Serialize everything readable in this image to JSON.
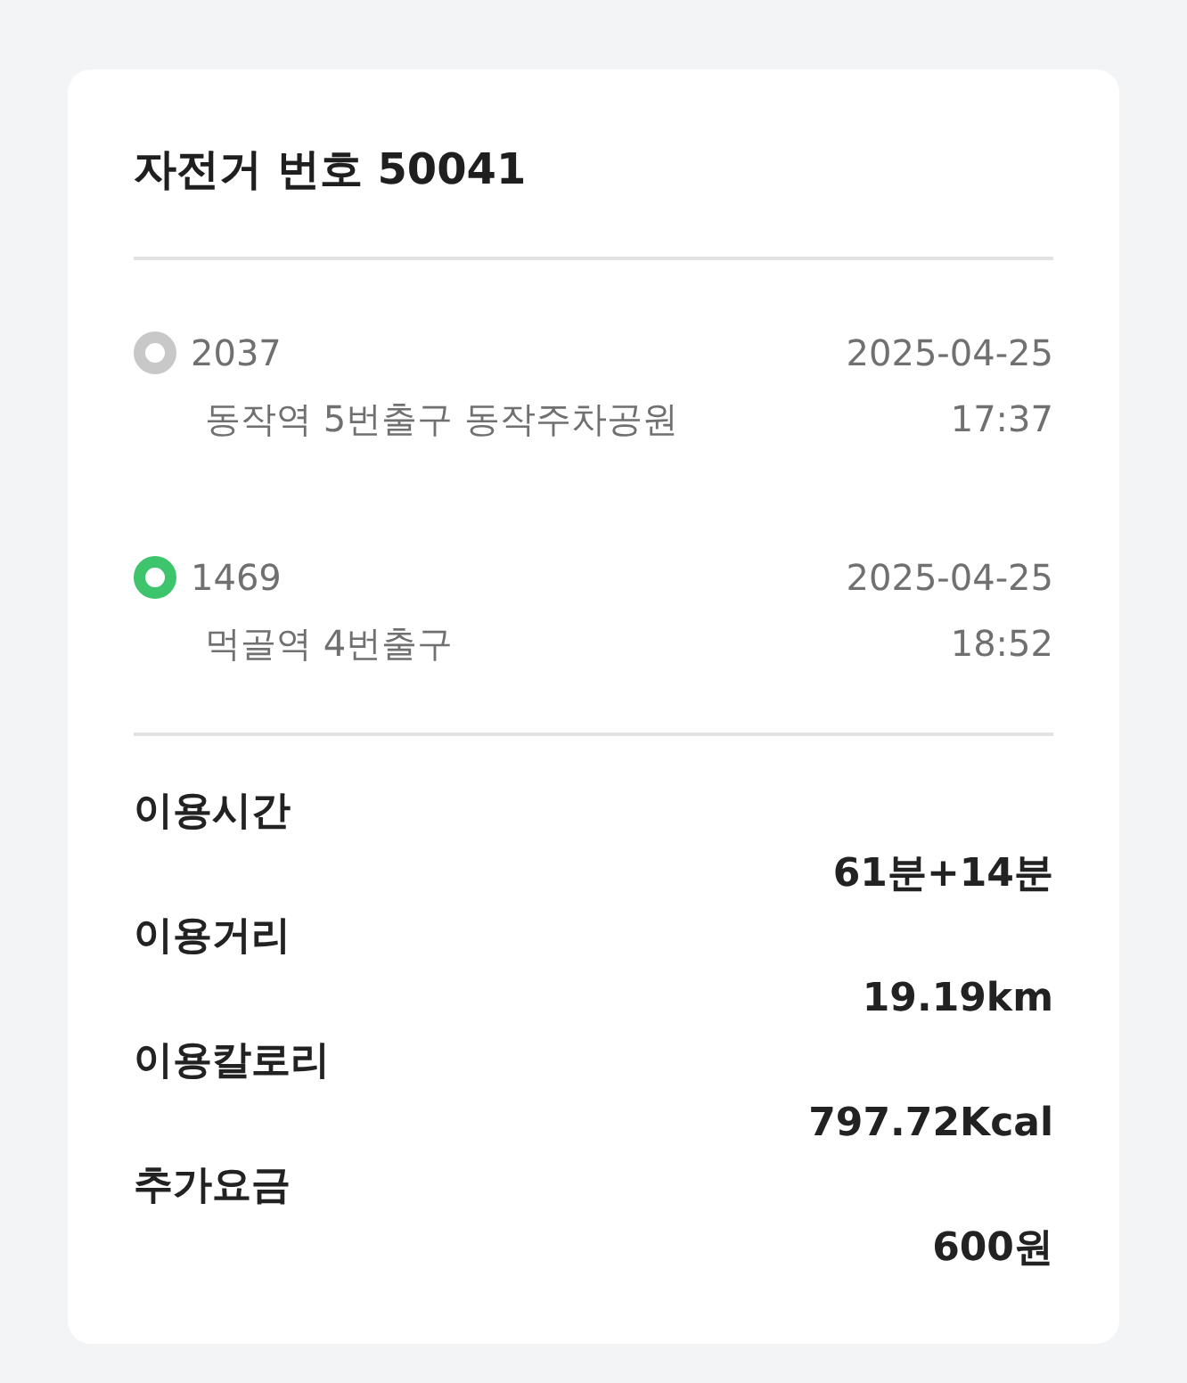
{
  "title": "자전거 번호 50041",
  "stations": [
    {
      "number": "2037",
      "name": "동작역 5번출구 동작주차공원",
      "date": "2025-04-25",
      "time": "17:37",
      "color": "#c8c8c8"
    },
    {
      "number": "1469",
      "name": "먹골역 4번출구",
      "date": "2025-04-25",
      "time": "18:52",
      "color": "#3ec46d"
    }
  ],
  "stats": [
    {
      "label": "이용시간",
      "value": "61분+14분"
    },
    {
      "label": "이용거리",
      "value": "19.19km"
    },
    {
      "label": "이용칼로리",
      "value": "797.72Kcal"
    },
    {
      "label": "추가요금",
      "value": "600원"
    }
  ]
}
